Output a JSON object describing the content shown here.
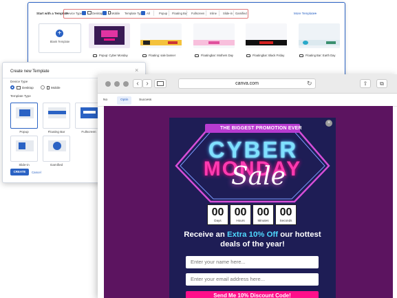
{
  "gallery": {
    "title": "Start with a Template",
    "device_type_label": "Device Type",
    "desktop_label": "Desktop",
    "mobile_label": "Mobile",
    "template_type_label": "Template Type",
    "all_label": "All",
    "filters": [
      "Popup",
      "Floating Bar",
      "Fullscreen",
      "Inline",
      "Slide-in",
      "Gamified"
    ],
    "more_templates": "More Templates",
    "new_template_label": "Blank Template",
    "templates": [
      {
        "label": "Popup: Cyber Monday"
      },
      {
        "label": "Floating: sale banner"
      },
      {
        "label": "Floatingbar: Mothers Day"
      },
      {
        "label": "Floatingbar: Black Friday"
      },
      {
        "label": "Floating Bar: Earth Day"
      }
    ]
  },
  "dialog": {
    "title": "Create new Template",
    "close": "×",
    "device_type_label": "Device Type",
    "desktop_option": "Desktop",
    "mobile_option": "Mobile",
    "template_type_label": "Template Type",
    "types": [
      {
        "label": "Popup"
      },
      {
        "label": "Floating Bar"
      },
      {
        "label": "Fullscreen"
      },
      {
        "label": "Slide-in"
      },
      {
        "label": "Gamified"
      }
    ],
    "create_label": "CREATE",
    "cancel_label": "Cancel"
  },
  "browser": {
    "url": "canva.com",
    "reload": "↻",
    "back": "‹",
    "forward": "›",
    "tabs": [
      "No",
      "Optin",
      "Success"
    ],
    "active_tab": "Optin"
  },
  "popup": {
    "close": "×",
    "banner": "THE BIGGEST PROMOTION EVER",
    "cyber": "CYBER",
    "monday": "MONDAY",
    "sale": "Sale",
    "countdown": [
      {
        "value": "00",
        "unit": "Days"
      },
      {
        "value": "00",
        "unit": "Hours"
      },
      {
        "value": "00",
        "unit": "Minutes"
      },
      {
        "value": "00",
        "unit": "Seconds"
      }
    ],
    "headline_pre": "Receive an ",
    "headline_highlight": "Extra 10% Off",
    "headline_post": " our hottest deals of the year!",
    "name_placeholder": "Enter your name here...",
    "email_placeholder": "Enter your email address here...",
    "cta": "Send Me 10% Discount Code!"
  },
  "colors": {
    "accent": "#2a62c4",
    "popup_bg": "#1e1d55",
    "stage_bg": "#5c1460",
    "cta_pink": "#ff0f8a"
  }
}
